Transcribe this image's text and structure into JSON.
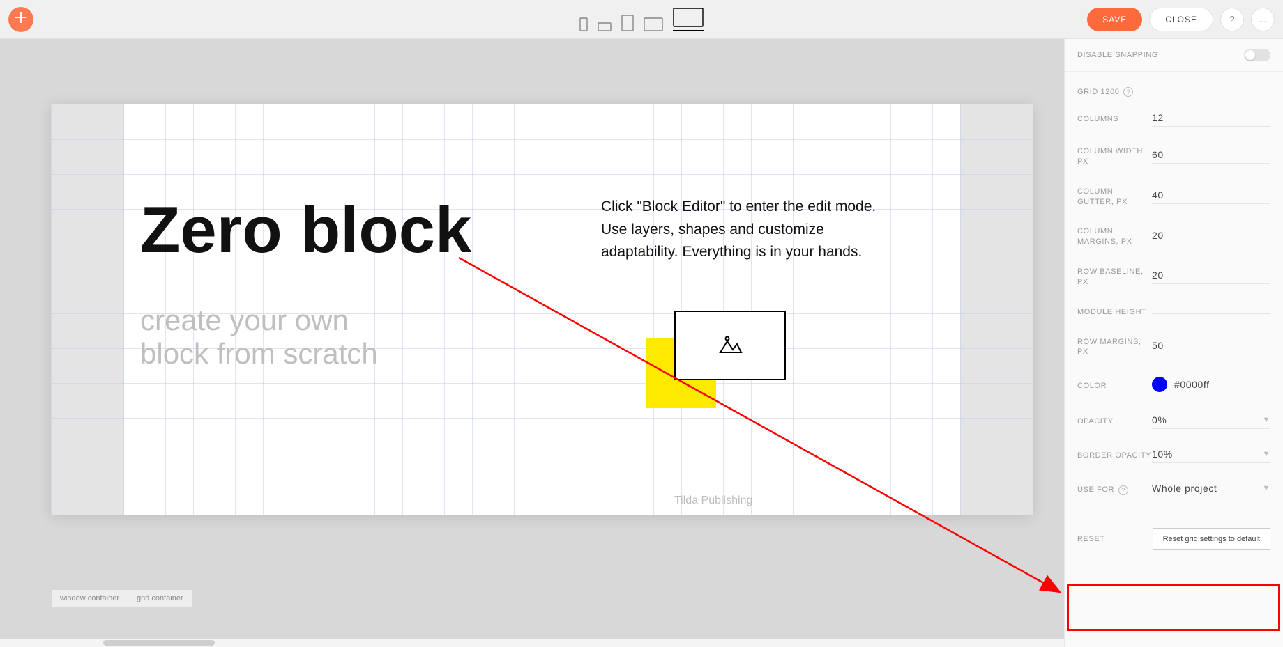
{
  "topbar": {
    "save_label": "SAVE",
    "close_label": "CLOSE",
    "help_label": "?",
    "more_label": "..."
  },
  "canvas": {
    "title": "Zero block",
    "subtitle_line1": "create your own",
    "subtitle_line2": "block from scratch",
    "instructions_line1": "Click \"Block Editor\" to enter the edit mode.",
    "instructions_line2": "Use layers, shapes and customize",
    "instructions_line3": "adaptability. Everything is in your hands.",
    "credit": "Tilda Publishing"
  },
  "footer": {
    "tab1": "window container",
    "tab2": "grid container"
  },
  "sidebar": {
    "disable_snapping": "DISABLE SNAPPING",
    "grid_section": "GRID 1200",
    "columns_label": "COLUMNS",
    "columns_value": "12",
    "col_width_label": "COLUMN WIDTH, PX",
    "col_width_value": "60",
    "col_gutter_label": "COLUMN GUTTER, PX",
    "col_gutter_value": "40",
    "col_margins_label": "COLUMN MARGINS, PX",
    "col_margins_value": "20",
    "row_baseline_label": "ROW BASELINE, PX",
    "row_baseline_value": "20",
    "module_height_label": "MODULE HEIGHT",
    "module_height_value": "",
    "row_margins_label": "ROW MARGINS, PX",
    "row_margins_value": "50",
    "color_label": "COLOR",
    "color_hex": "#0000ff",
    "color_swatch": "#0000ff",
    "opacity_label": "OPACITY",
    "opacity_value": "0%",
    "border_opacity_label": "BORDER OPACITY",
    "border_opacity_value": "10%",
    "use_for_label": "USE FOR",
    "use_for_value": "Whole project",
    "reset_label": "RESET",
    "reset_button": "Reset grid settings to default"
  }
}
